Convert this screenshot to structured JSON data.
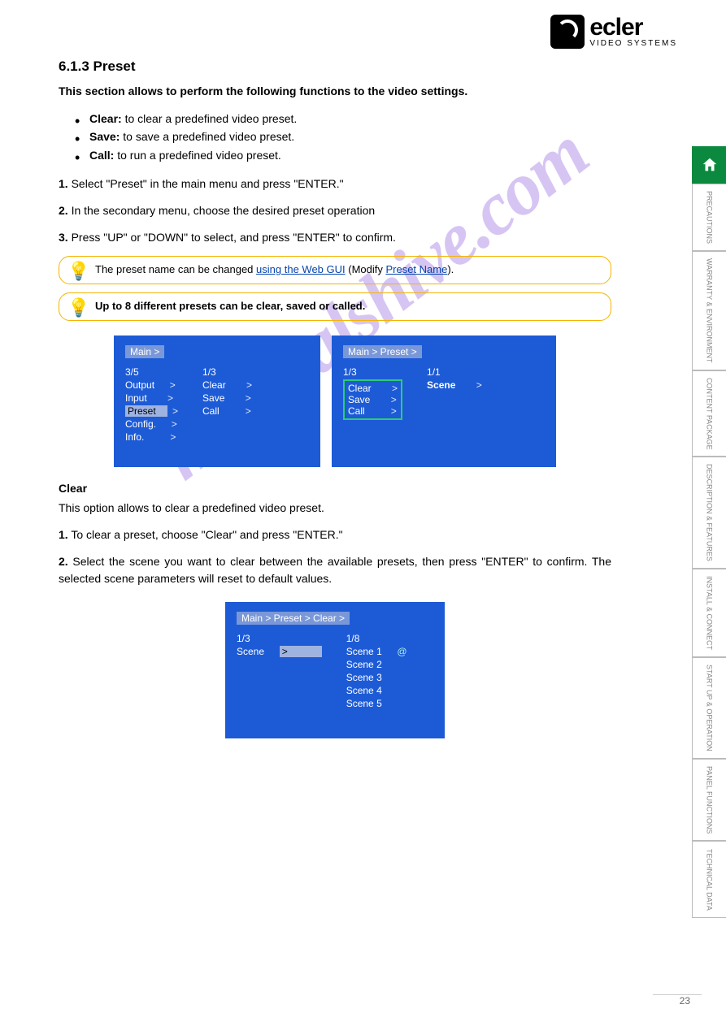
{
  "logo": {
    "brand": "ecler",
    "sub": "VIDEO SYSTEMS"
  },
  "sidenav": {
    "items": [
      {
        "label": "",
        "type": "home"
      },
      {
        "label": "PRECAUTIONS"
      },
      {
        "label": "WARRANTY & ENVIRONMENT"
      },
      {
        "label": "CONTENT PACKAGE"
      },
      {
        "label": "DESCRIPTION & FEATURES"
      },
      {
        "label": "INSTALL & CONNECT"
      },
      {
        "label": "START UP & OPERATION"
      },
      {
        "label": "PANEL FUNCTIONS"
      },
      {
        "label": "TECHNICAL DATA"
      }
    ]
  },
  "title": "6.1.3 Preset",
  "intro": {
    "p1": "This section allows to perform the following functions to the video settings.",
    "li1_b": "Clear:",
    "li1": " to clear a predefined video preset.",
    "li2_b": "Save:",
    "li2": " to save a predefined video preset.",
    "li3_b": "Call:",
    "li3": " to run a predefined video preset."
  },
  "steps": {
    "s1_n": "1.",
    "s1": "Select \"Preset\" in the main menu and press \"ENTER.\"",
    "s2_n": "2.",
    "s2": "In the secondary menu, choose the desired preset operation",
    "s3_n": "3.",
    "s3": "Press \"UP\" or \"DOWN\" to select, and press \"ENTER\" to confirm."
  },
  "callout1": {
    "pre": "The preset name can be changed ",
    "link1": "using the Web GUI",
    "mid": " (Modify ",
    "link2": "Preset Name",
    "post": ")."
  },
  "callout2": "Up to 8 different presets can be clear, saved or called.",
  "osdA": {
    "crumb": "Main  >",
    "idx1": "3/5",
    "idx2": "1/3",
    "l1": "Output",
    "l2": "Input",
    "l3": "Preset",
    "l4": "Config.",
    "l5": "Info.",
    "r1": "Clear",
    "r2": "Save",
    "r3": "Call"
  },
  "osdB": {
    "crumb": "Main  >   Preset  >",
    "idx1": "1/3",
    "idx2": "1/1",
    "b1": "Clear",
    "b2": "Save",
    "b3": "Call",
    "r1": "Scene"
  },
  "sectClear": {
    "head": "Clear",
    "p": "This option allows to clear a predefined video preset.",
    "s1_n": "1.",
    "s1": "To clear a preset, choose \"Clear\" and press \"ENTER.\"",
    "s2_n": "2.",
    "s2": "Select the scene you want to clear between the available presets, then press \"ENTER\" to confirm. The selected scene parameters will reset to default values."
  },
  "osdC": {
    "crumb": "Main  >   Preset  > Clear  >",
    "idx1": "1/3",
    "idx2": "1/8",
    "left": "Scene",
    "scenes": [
      "Scene 1",
      "Scene 2",
      "Scene 3",
      "Scene 4",
      "Scene 5"
    ],
    "at": "@"
  },
  "pagenum": "23"
}
